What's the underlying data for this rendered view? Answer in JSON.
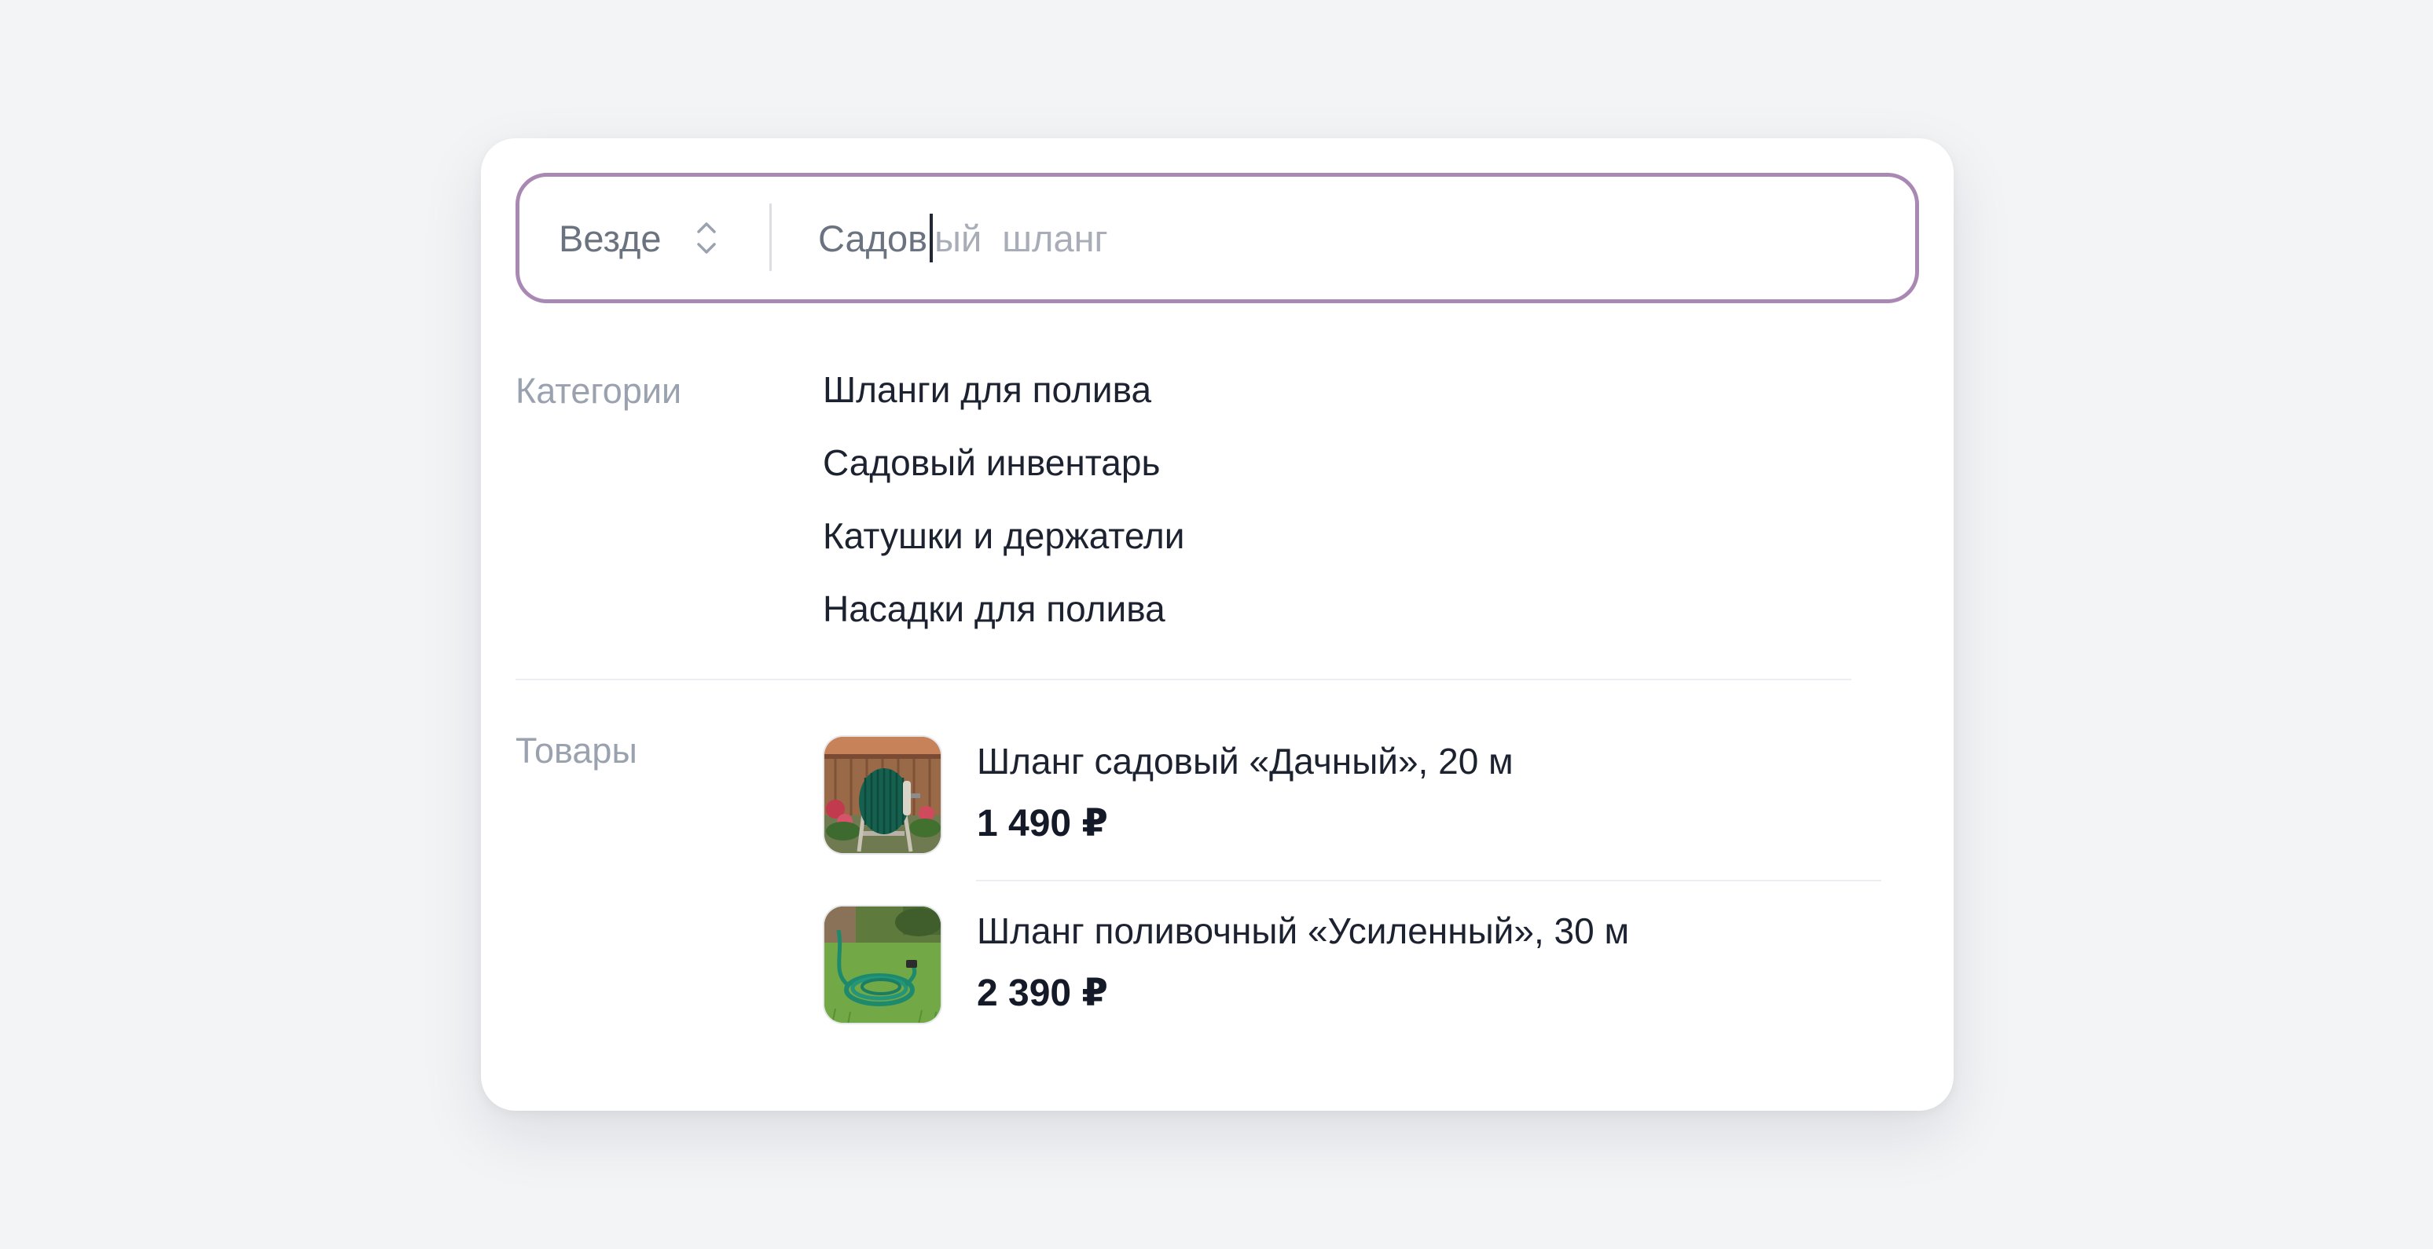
{
  "search": {
    "scope_label": "Везде",
    "scope_icon": "updown-chevron-icon",
    "typed_text": "Садов",
    "suggestion_text": "ый  шланг"
  },
  "categories": {
    "label": "Категории",
    "items": [
      {
        "label": "Шланги для полива"
      },
      {
        "label": "Садовый инвентарь"
      },
      {
        "label": "Катушки и держатели"
      },
      {
        "label": "Насадки для полива"
      }
    ]
  },
  "products": {
    "label": "Товары",
    "items": [
      {
        "title": "Шланг садовый «Дачный», 20 м",
        "price": "1 490 ₽",
        "image": "hose-reel-garden-photo"
      },
      {
        "title": "Шланг поливочный «Усиленный», 30 м",
        "price": "2 390 ₽",
        "image": "hose-on-lawn-photo"
      }
    ]
  },
  "colors": {
    "accent_border": "#a989b4",
    "background": "#f3f4f6",
    "muted_text": "#9aa2af"
  }
}
